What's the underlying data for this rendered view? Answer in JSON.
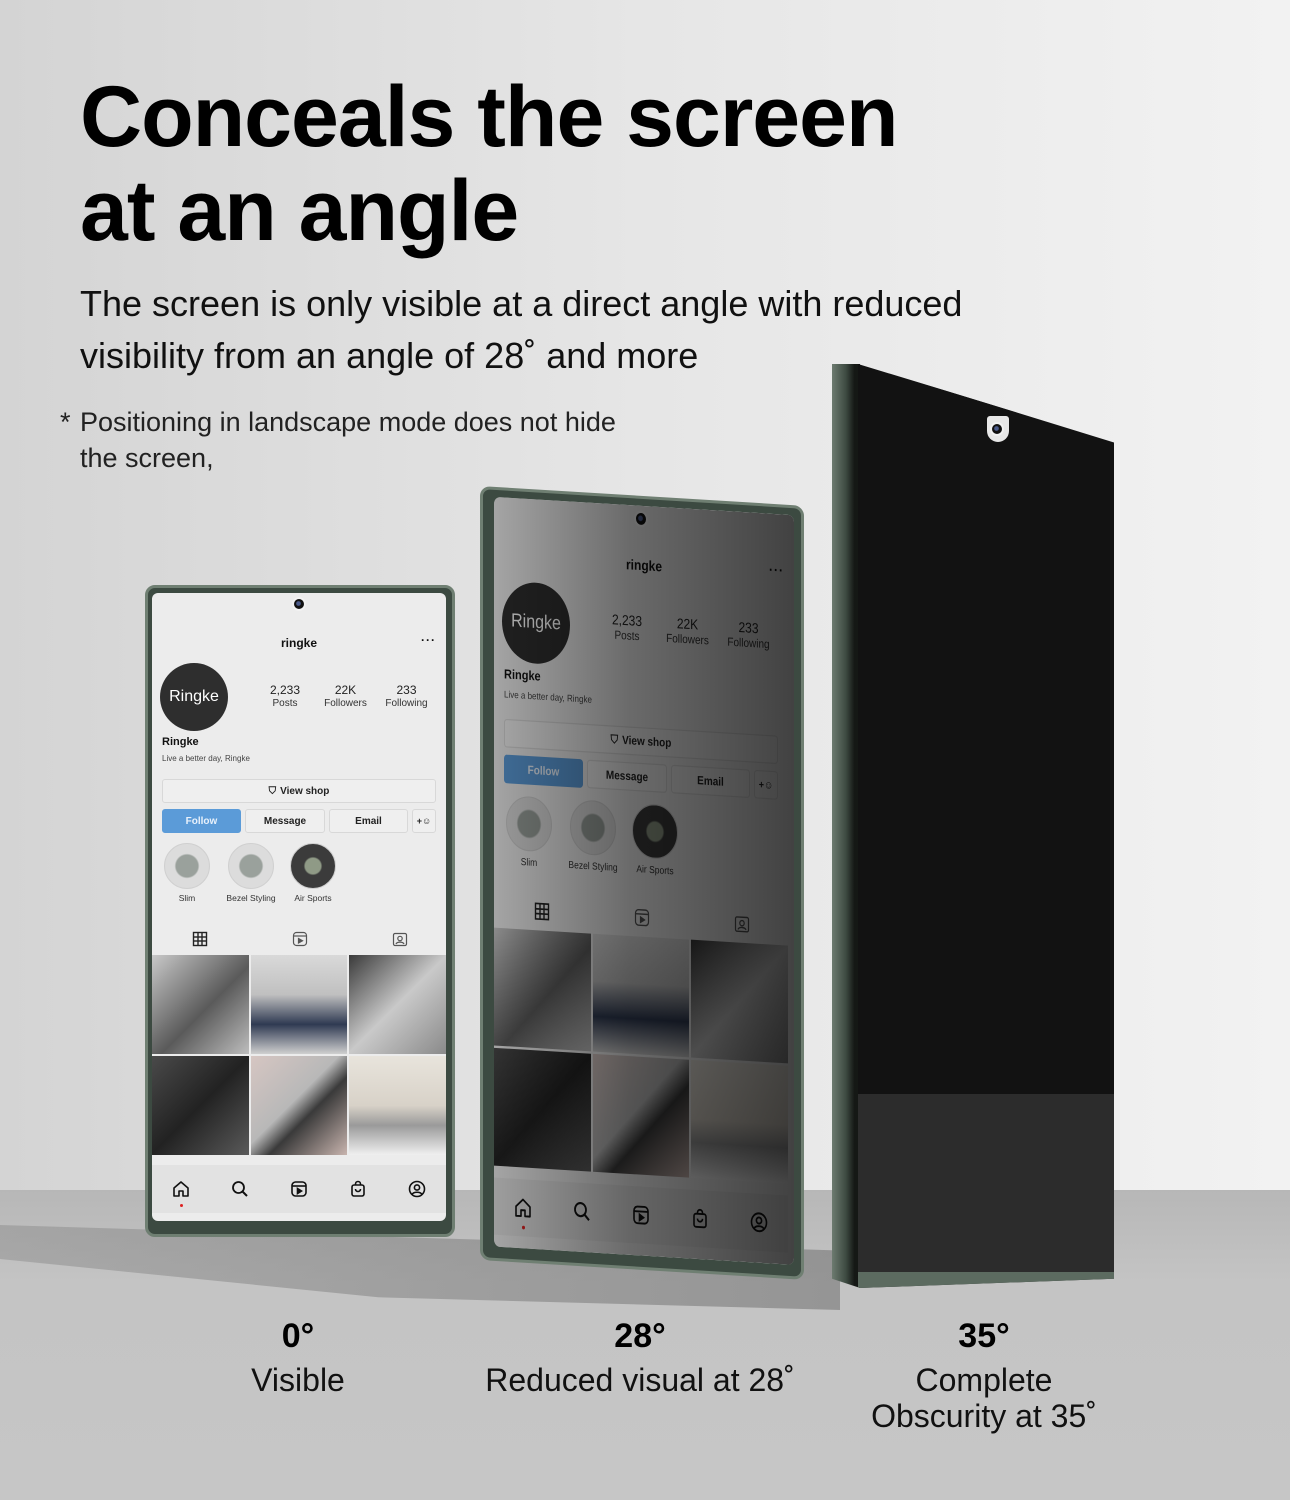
{
  "headline": {
    "line1": "Conceals the screen",
    "line2": "at an angle"
  },
  "subhead": {
    "line1": "The screen is only visible at a direct angle with reduced",
    "line2": "visibility from an angle of 28˚ and more"
  },
  "note": {
    "asterisk": "*",
    "line1": "Positioning in landscape mode does not hide",
    "line2": "the screen,"
  },
  "profile": {
    "username": "ringke",
    "more_icon": "···",
    "avatar_text": "Ringke",
    "stats": [
      {
        "value": "2,233",
        "label": "Posts"
      },
      {
        "value": "22K",
        "label": "Followers"
      },
      {
        "value": "233",
        "label": "Following"
      }
    ],
    "display_name": "Ringke",
    "bio": "Live a better day, Ringke",
    "view_shop_label": "View shop",
    "buttons": {
      "follow": "Follow",
      "message": "Message",
      "email": "Email",
      "add_user": "+👤"
    },
    "highlights": [
      {
        "label": "Slim"
      },
      {
        "label": "Bezel Styling"
      },
      {
        "label": "Air Sports"
      }
    ],
    "follow_color": "#5b9bd8"
  },
  "angles": [
    {
      "degree": "0°",
      "description": "Visible"
    },
    {
      "degree": "28°",
      "description": "Reduced visual at 28˚"
    },
    {
      "degree": "35°",
      "description_line1": "Complete",
      "description_line2": "Obscurity at 35˚"
    }
  ],
  "phone_frame_color": "#3c4a41"
}
